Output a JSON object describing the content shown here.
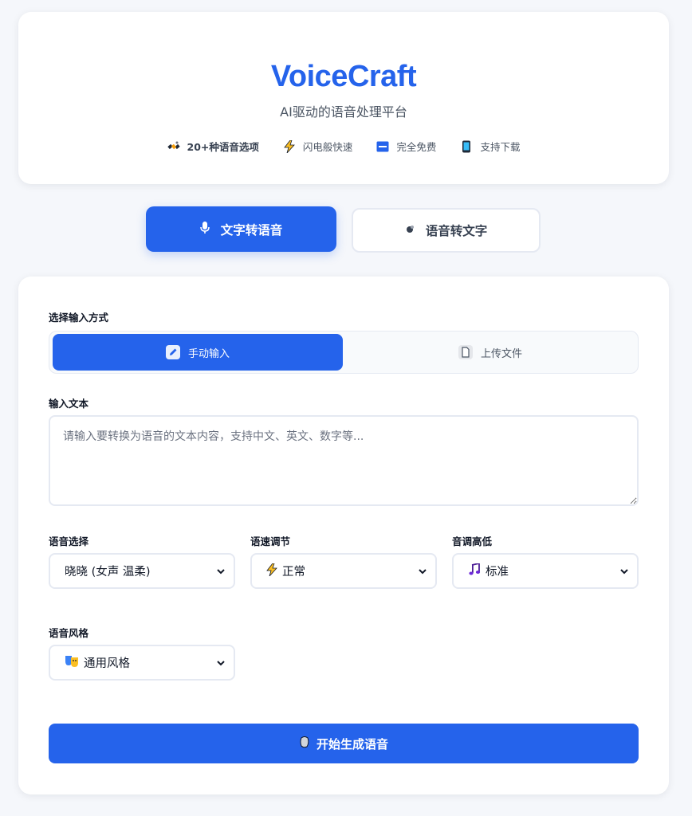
{
  "header": {
    "brand": "VoiceCraft",
    "subtitle": "AI驱动的语音处理平台",
    "features": [
      {
        "icon": "satellite-icon",
        "label": "20+种语音选项"
      },
      {
        "icon": "lightning-icon",
        "label": "闪电般快速"
      },
      {
        "icon": "free-badge-icon",
        "label": "完全免费"
      },
      {
        "icon": "mobile-phone-icon",
        "label": "支持下载"
      }
    ]
  },
  "mode_tabs": {
    "tts": {
      "icon": "microphone-icon",
      "label": "文字转语音",
      "active": true
    },
    "stt": {
      "icon": "bubble-icon",
      "label": "语音转文字",
      "active": false
    }
  },
  "form": {
    "input_method_label": "选择输入方式",
    "methods": [
      {
        "icon": "pencil-icon",
        "label": "手动输入",
        "active": true
      },
      {
        "icon": "file-icon",
        "label": "上传文件",
        "active": false
      }
    ],
    "text_label": "输入文本",
    "text_value": "",
    "text_placeholder": "请输入要转换为语音的文本内容，支持中文、英文、数字等...",
    "voice": {
      "label": "语音选择",
      "value": "晓晓 (女声 温柔)"
    },
    "speed": {
      "label": "语速调节",
      "icon": "lightning-icon",
      "value": "正常"
    },
    "pitch": {
      "label": "音调高低",
      "icon": "music-note-icon",
      "value": "标准"
    },
    "style": {
      "label": "语音风格",
      "icon": "theater-masks-icon",
      "value": "通用风格"
    },
    "submit": {
      "icon": "rock-icon",
      "label": "开始生成语音"
    }
  },
  "colors": {
    "primary": "#2563eb",
    "background": "#f5f7fb",
    "card": "#ffffff",
    "border": "#e5e9f2",
    "muted_text": "#4b5563"
  }
}
